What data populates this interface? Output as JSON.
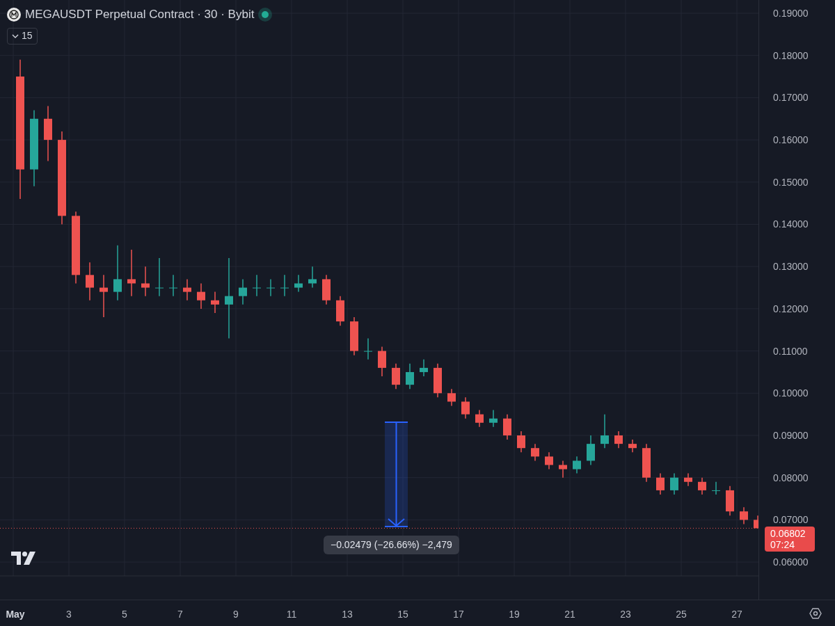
{
  "header": {
    "symbol": "MEGAUSDT Perpetual Contract · 30 · Bybit",
    "market_open": true,
    "indicator_count": "15"
  },
  "chart_data": {
    "type": "candlestick",
    "yticks": [
      {
        "value": 0.19,
        "label": "0.19000"
      },
      {
        "value": 0.18,
        "label": "0.18000"
      },
      {
        "value": 0.17,
        "label": "0.17000"
      },
      {
        "value": 0.16,
        "label": "0.16000"
      },
      {
        "value": 0.15,
        "label": "0.15000"
      },
      {
        "value": 0.14,
        "label": "0.14000"
      },
      {
        "value": 0.13,
        "label": "0.13000"
      },
      {
        "value": 0.12,
        "label": "0.12000"
      },
      {
        "value": 0.11,
        "label": "0.11000"
      },
      {
        "value": 0.1,
        "label": "0.10000"
      },
      {
        "value": 0.09,
        "label": "0.09000"
      },
      {
        "value": 0.08,
        "label": "0.08000"
      },
      {
        "value": 0.07,
        "label": "0.07000"
      },
      {
        "value": 0.06,
        "label": "0.06000"
      }
    ],
    "xticks": [
      {
        "value": 1,
        "label": "May"
      },
      {
        "value": 3,
        "label": "3"
      },
      {
        "value": 5,
        "label": "5"
      },
      {
        "value": 7,
        "label": "7"
      },
      {
        "value": 9,
        "label": "9"
      },
      {
        "value": 11,
        "label": "11"
      },
      {
        "value": 13,
        "label": "13"
      },
      {
        "value": 15,
        "label": "15"
      },
      {
        "value": 17,
        "label": "17"
      },
      {
        "value": 19,
        "label": "19"
      },
      {
        "value": 21,
        "label": "21"
      },
      {
        "value": 23,
        "label": "23"
      },
      {
        "value": 25,
        "label": "25"
      },
      {
        "value": 27,
        "label": "27"
      }
    ],
    "xlim": [
      0.525,
      30.525
    ],
    "grid": true,
    "ref_lines": [
      {
        "axis": "y",
        "value": 0.06802,
        "color": "#ef5350"
      }
    ],
    "ylim": [
      0.05672,
      0.19313
    ],
    "x": [
      1.25,
      1.75,
      2.25,
      2.75,
      3.25,
      3.75,
      4.25,
      4.75,
      5.25,
      5.75,
      6.25,
      6.75,
      7.25,
      7.75,
      8.25,
      8.75,
      9.25,
      9.75,
      10.25,
      10.75,
      11.25,
      11.75,
      12.25,
      12.75,
      13.25,
      13.75,
      14.25,
      14.75,
      15.25,
      15.75,
      16.25,
      16.75,
      17.25,
      17.75,
      18.25,
      18.75,
      19.25,
      19.75,
      20.25,
      20.75,
      21.25,
      21.75,
      22.25,
      22.75,
      23.25,
      23.75,
      24.25,
      24.75,
      25.25,
      25.75,
      26.25,
      26.75,
      27.25,
      27.75
    ],
    "ohlc": [
      [
        0.175,
        0.179,
        0.146,
        0.153
      ],
      [
        0.153,
        0.167,
        0.149,
        0.165
      ],
      [
        0.165,
        0.168,
        0.155,
        0.16
      ],
      [
        0.16,
        0.162,
        0.14,
        0.142
      ],
      [
        0.142,
        0.143,
        0.126,
        0.128
      ],
      [
        0.128,
        0.131,
        0.122,
        0.125
      ],
      [
        0.125,
        0.128,
        0.118,
        0.124
      ],
      [
        0.124,
        0.135,
        0.122,
        0.127
      ],
      [
        0.127,
        0.134,
        0.123,
        0.126
      ],
      [
        0.126,
        0.13,
        0.123,
        0.125
      ],
      [
        0.125,
        0.132,
        0.123,
        0.125
      ],
      [
        0.125,
        0.128,
        0.123,
        0.125
      ],
      [
        0.125,
        0.127,
        0.122,
        0.124
      ],
      [
        0.124,
        0.126,
        0.12,
        0.122
      ],
      [
        0.122,
        0.124,
        0.119,
        0.121
      ],
      [
        0.121,
        0.132,
        0.113,
        0.123
      ],
      [
        0.123,
        0.127,
        0.121,
        0.125
      ],
      [
        0.125,
        0.128,
        0.123,
        0.125
      ],
      [
        0.125,
        0.127,
        0.123,
        0.125
      ],
      [
        0.125,
        0.128,
        0.123,
        0.125
      ],
      [
        0.125,
        0.128,
        0.124,
        0.126
      ],
      [
        0.126,
        0.13,
        0.125,
        0.127
      ],
      [
        0.127,
        0.128,
        0.121,
        0.122
      ],
      [
        0.122,
        0.123,
        0.116,
        0.117
      ],
      [
        0.117,
        0.118,
        0.109,
        0.11
      ],
      [
        0.11,
        0.113,
        0.108,
        0.11
      ],
      [
        0.11,
        0.111,
        0.104,
        0.106
      ],
      [
        0.106,
        0.107,
        0.101,
        0.102
      ],
      [
        0.102,
        0.107,
        0.101,
        0.105
      ],
      [
        0.105,
        0.108,
        0.104,
        0.106
      ],
      [
        0.106,
        0.107,
        0.099,
        0.1
      ],
      [
        0.1,
        0.101,
        0.097,
        0.098
      ],
      [
        0.098,
        0.099,
        0.094,
        0.095
      ],
      [
        0.095,
        0.096,
        0.092,
        0.093
      ],
      [
        0.093,
        0.096,
        0.092,
        0.094
      ],
      [
        0.094,
        0.095,
        0.089,
        0.09
      ],
      [
        0.09,
        0.091,
        0.086,
        0.087
      ],
      [
        0.087,
        0.088,
        0.084,
        0.085
      ],
      [
        0.085,
        0.086,
        0.082,
        0.083
      ],
      [
        0.083,
        0.084,
        0.08,
        0.082
      ],
      [
        0.082,
        0.085,
        0.081,
        0.084
      ],
      [
        0.084,
        0.09,
        0.083,
        0.088
      ],
      [
        0.088,
        0.095,
        0.087,
        0.09
      ],
      [
        0.09,
        0.091,
        0.087,
        0.088
      ],
      [
        0.088,
        0.089,
        0.086,
        0.087
      ],
      [
        0.087,
        0.088,
        0.079,
        0.08
      ],
      [
        0.08,
        0.081,
        0.076,
        0.077
      ],
      [
        0.077,
        0.081,
        0.076,
        0.08
      ],
      [
        0.08,
        0.081,
        0.078,
        0.079
      ],
      [
        0.079,
        0.08,
        0.076,
        0.077
      ],
      [
        0.077,
        0.079,
        0.076,
        0.077
      ],
      [
        0.077,
        0.078,
        0.071,
        0.072
      ],
      [
        0.072,
        0.073,
        0.069,
        0.07
      ],
      [
        0.07,
        0.071,
        0.068,
        0.06802
      ]
    ]
  },
  "last_price": {
    "price": "0.06802",
    "countdown": "07:24"
  },
  "measure": {
    "label": "−0.02479 (−26.66%) −2,479"
  }
}
